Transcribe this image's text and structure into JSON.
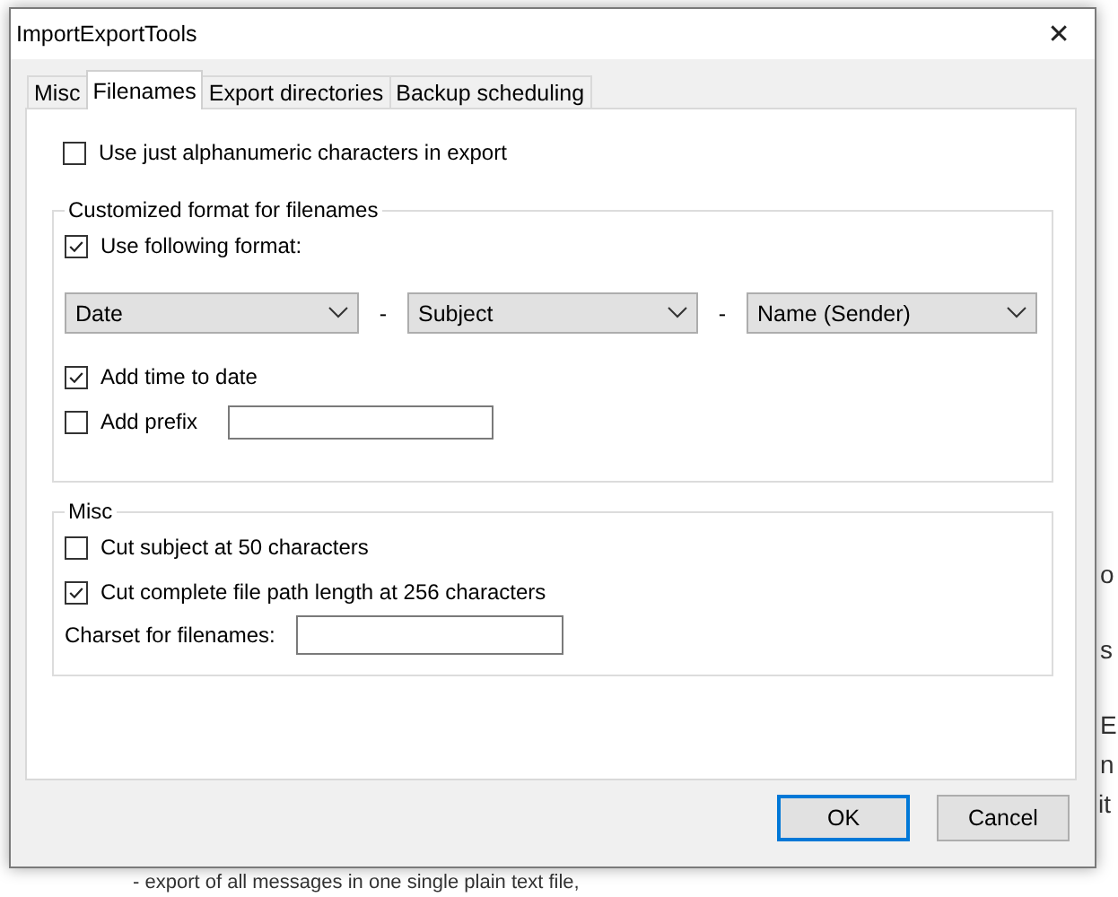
{
  "background": {
    "fragments": [
      "o",
      "s",
      "E",
      "n",
      "it"
    ],
    "bottom_line": "- export of all messages in one single plain text file,"
  },
  "window": {
    "title": "ImportExportTools",
    "close": "✕"
  },
  "tabs": [
    {
      "label": "Misc",
      "selected": false
    },
    {
      "label": "Filenames",
      "selected": true
    },
    {
      "label": "Export directories",
      "selected": false
    },
    {
      "label": "Backup scheduling",
      "selected": false
    }
  ],
  "top_option": {
    "label": "Use just alphanumeric characters in export",
    "checked": false
  },
  "format_group": {
    "title": "Customized format for filenames",
    "use_format": {
      "label": "Use following format:",
      "checked": true
    },
    "parts": [
      {
        "value": "Date"
      },
      {
        "value": "Subject"
      },
      {
        "value": "Name (Sender)"
      }
    ],
    "separators": [
      "-",
      "-"
    ],
    "add_time": {
      "label": "Add time to date",
      "checked": true
    },
    "add_prefix": {
      "label": "Add prefix",
      "checked": false
    }
  },
  "misc_group": {
    "title": "Misc",
    "options": [
      {
        "label": "Cut subject at 50 characters",
        "checked": false
      },
      {
        "label": "Cut complete file path length at 256 characters",
        "checked": true
      }
    ],
    "charset_label": "Charset for filenames:"
  },
  "buttons": [
    {
      "label": "OK",
      "default": true
    },
    {
      "label": "Cancel",
      "default": false
    }
  ]
}
